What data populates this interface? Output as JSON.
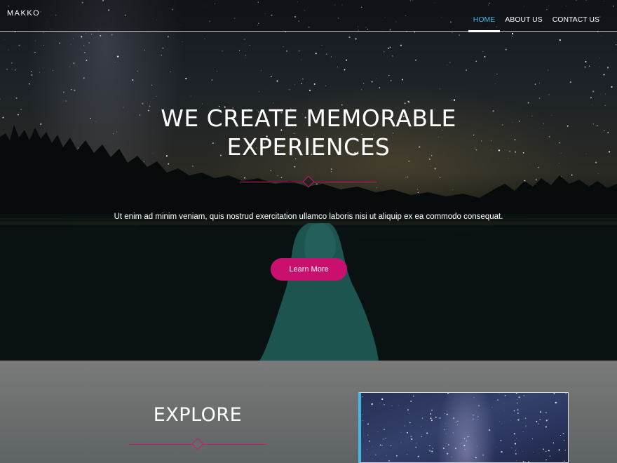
{
  "brand": "MAKKO",
  "nav": {
    "items": [
      {
        "label": "HOME",
        "active": true
      },
      {
        "label": "ABOUT US",
        "active": false
      },
      {
        "label": "CONTACT US",
        "active": false
      }
    ]
  },
  "hero": {
    "title_line1": "WE CREATE MEMORABLE",
    "title_line2": "EXPERIENCES",
    "text": "Ut enim ad minim veniam, quis nostrud exercitation ullamco laboris nisi ut aliquip ex ea commodo consequat.",
    "button_label": "Learn More"
  },
  "explore": {
    "title": "EXPLORE"
  },
  "colors": {
    "accent": "#c9106e",
    "nav_active": "#48b6e6",
    "image_border": "#45b7e1"
  }
}
